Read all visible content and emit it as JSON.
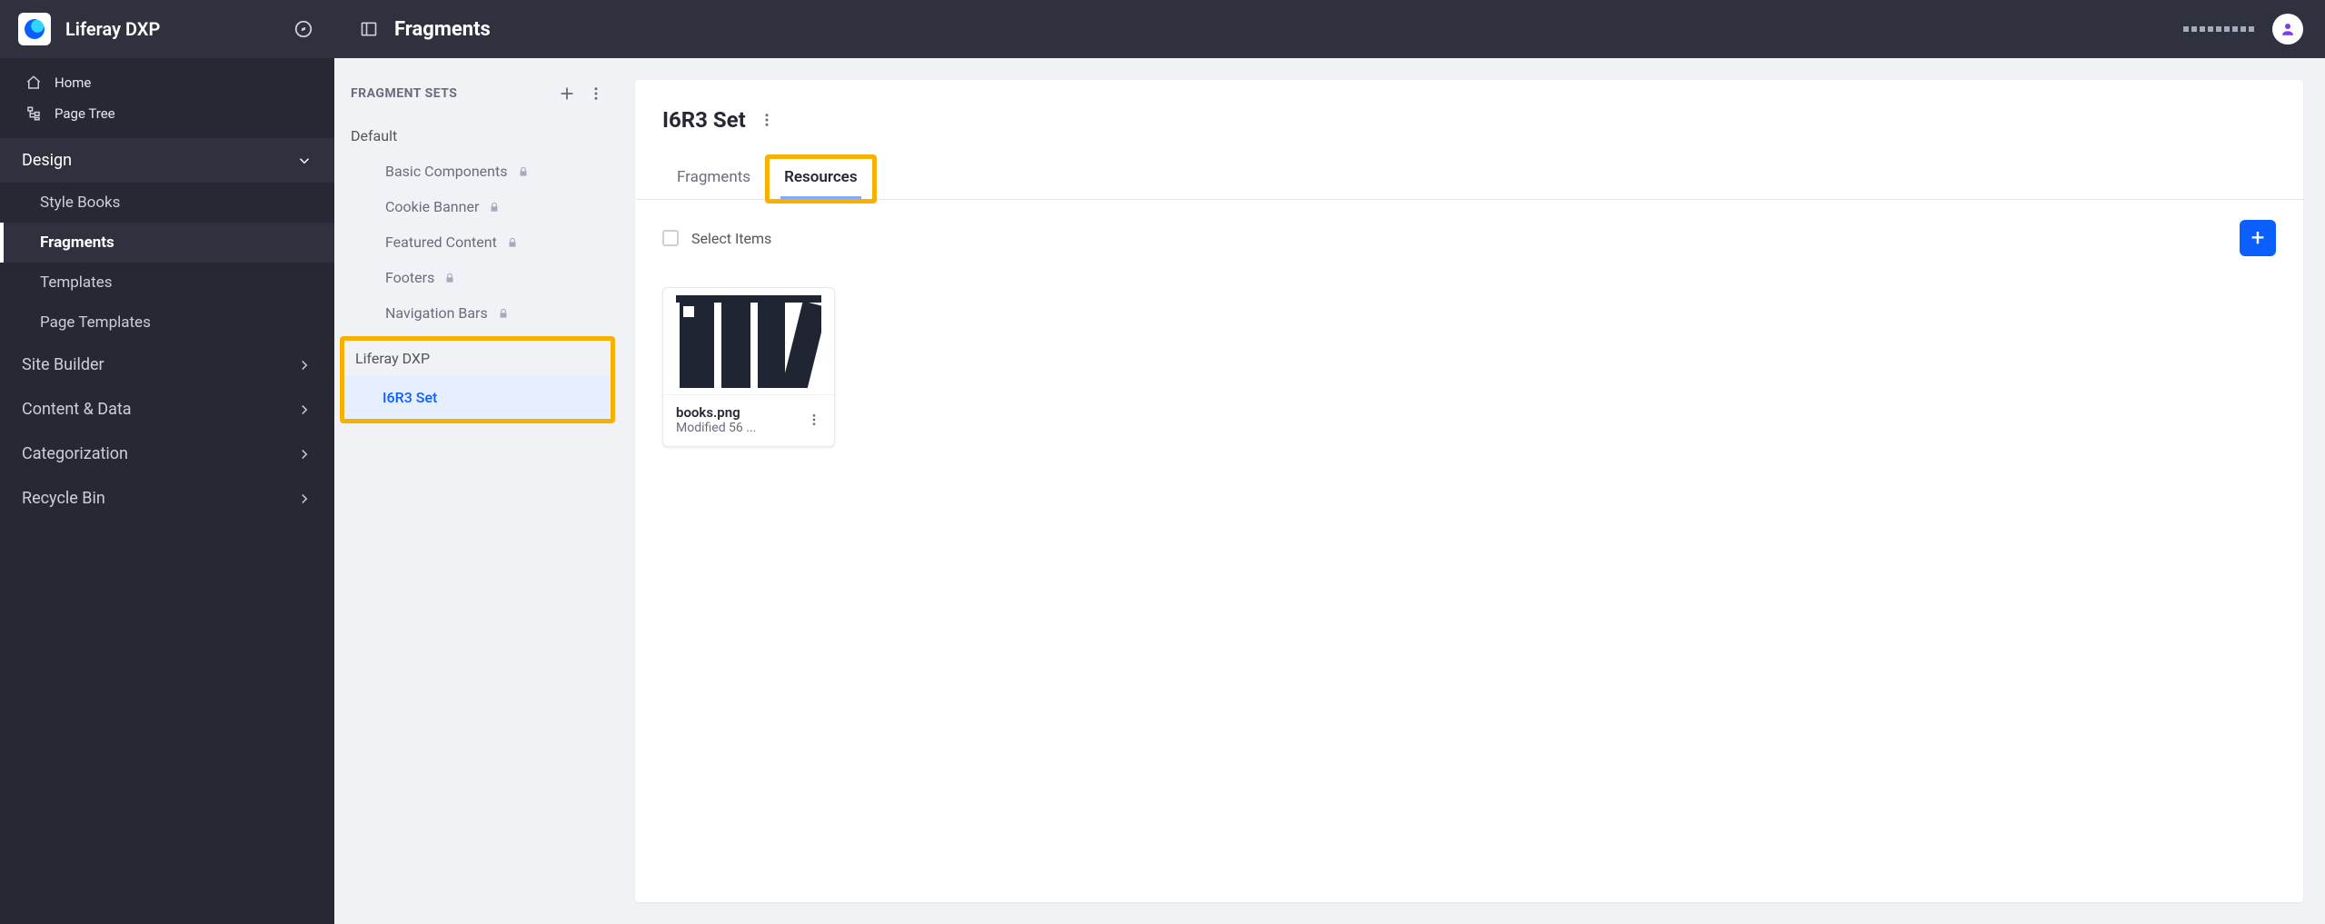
{
  "brand": {
    "name": "Liferay DXP"
  },
  "sidebar": {
    "quick": [
      {
        "label": "Home"
      },
      {
        "label": "Page Tree"
      }
    ],
    "expanded_section": {
      "label": "Design"
    },
    "design_children": [
      {
        "label": "Style Books"
      },
      {
        "label": "Fragments"
      },
      {
        "label": "Templates"
      },
      {
        "label": "Page Templates"
      }
    ],
    "collapsed": [
      {
        "label": "Site Builder"
      },
      {
        "label": "Content & Data"
      },
      {
        "label": "Categorization"
      },
      {
        "label": "Recycle Bin"
      }
    ]
  },
  "topbar": {
    "title": "Fragments"
  },
  "sets_panel": {
    "title": "FRAGMENT SETS",
    "default_group": "Default",
    "default_items": [
      {
        "label": "Basic Components"
      },
      {
        "label": "Cookie Banner"
      },
      {
        "label": "Featured Content"
      },
      {
        "label": "Footers"
      },
      {
        "label": "Navigation Bars"
      }
    ],
    "user_group": "Liferay DXP",
    "user_items": [
      {
        "label": "I6R3 Set"
      }
    ]
  },
  "content": {
    "title": "I6R3 Set",
    "tabs": [
      {
        "label": "Fragments"
      },
      {
        "label": "Resources"
      }
    ],
    "toolbar": {
      "select_label": "Select Items"
    },
    "resources": [
      {
        "name": "books.png",
        "modified": "Modified 56 ..."
      }
    ]
  }
}
